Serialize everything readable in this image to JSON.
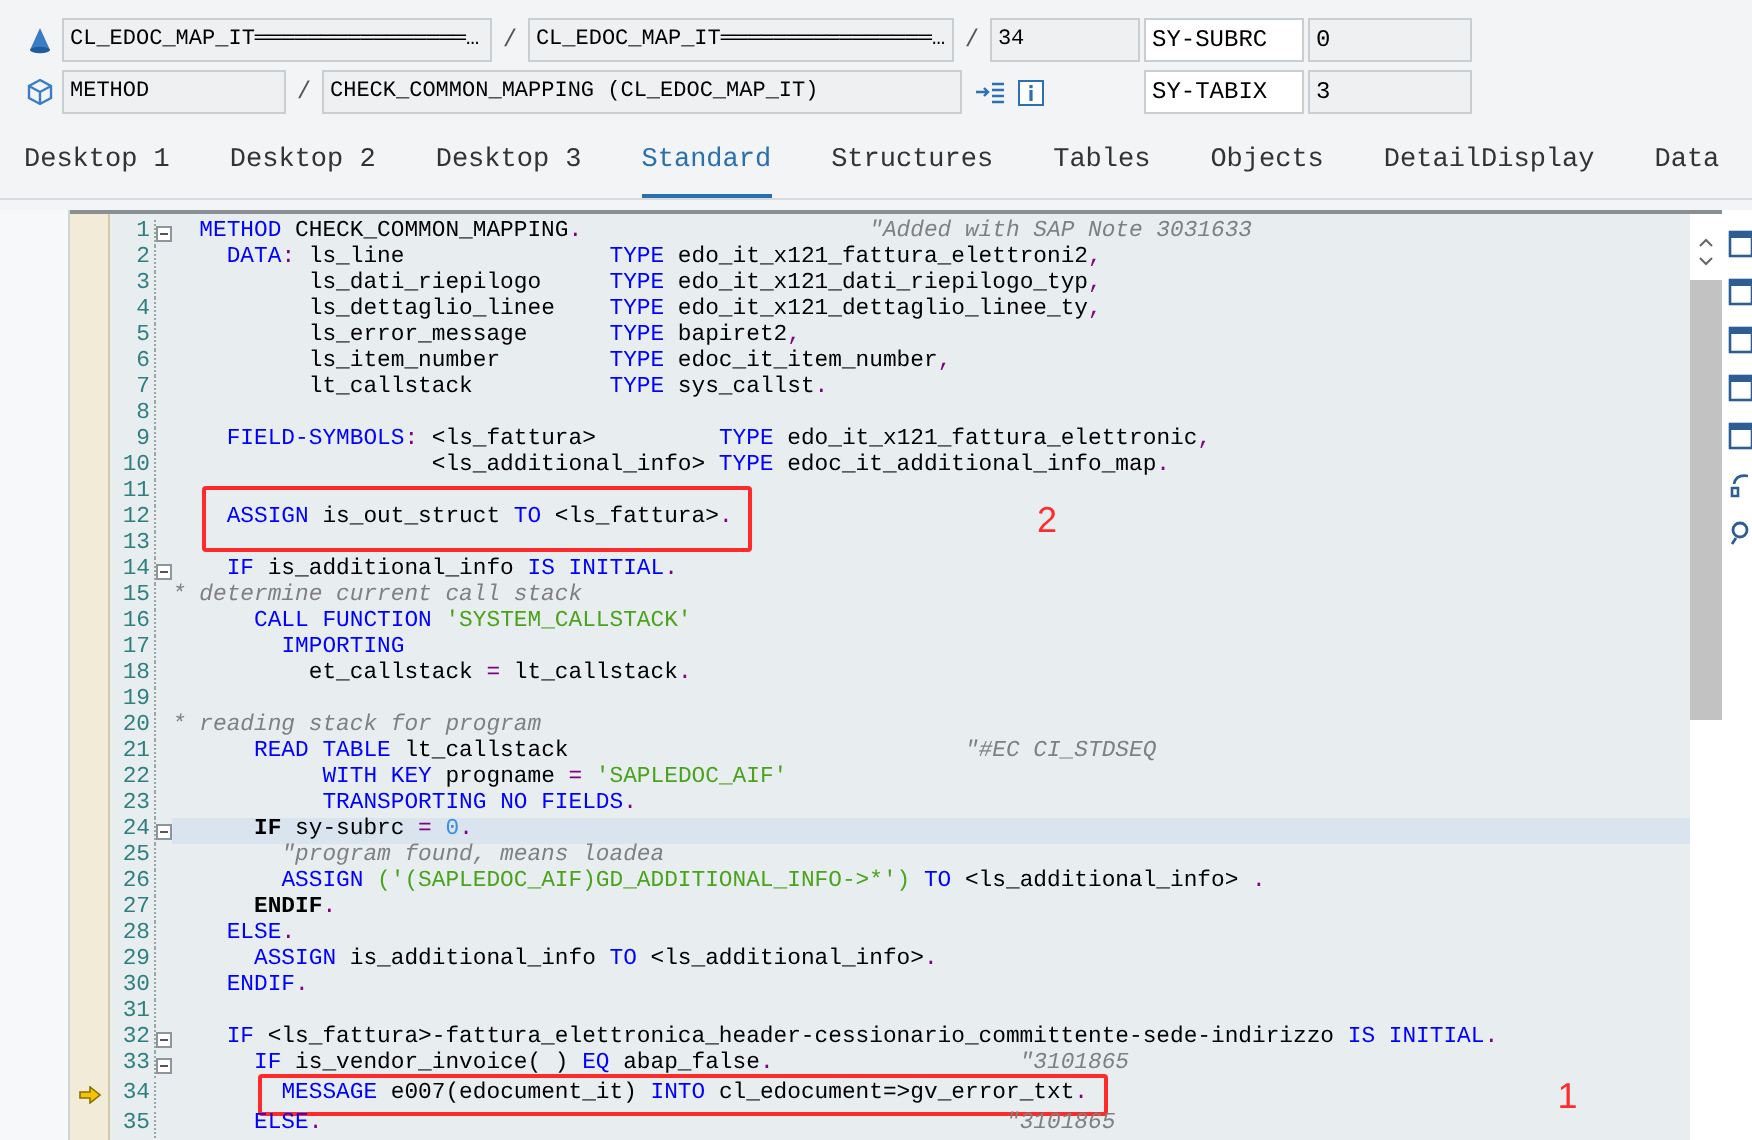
{
  "location_rows": [
    {
      "cells": [
        {
          "kind": "field",
          "text": "CL_EDOC_MAP_IT════════════════…"
        },
        {
          "kind": "separator",
          "text": "/"
        },
        {
          "kind": "field",
          "text": "CL_EDOC_MAP_IT════════════════…"
        },
        {
          "kind": "separator",
          "text": "/"
        },
        {
          "kind": "field",
          "text": "34"
        }
      ]
    },
    {
      "cells": [
        {
          "kind": "field",
          "text": "METHOD"
        },
        {
          "kind": "separator",
          "text": "/"
        },
        {
          "kind": "field",
          "text": "CHECK_COMMON_MAPPING (CL_EDOC_MAP_IT)"
        }
      ]
    }
  ],
  "system_fields": [
    {
      "name": "SY-SUBRC",
      "value": "0"
    },
    {
      "name": "SY-TABIX",
      "value": "3"
    }
  ],
  "tabs": [
    {
      "label": "Desktop 1",
      "selected": false
    },
    {
      "label": "Desktop 2",
      "selected": false
    },
    {
      "label": "Desktop 3",
      "selected": false
    },
    {
      "label": "Standard",
      "selected": true
    },
    {
      "label": "Structures",
      "selected": false
    },
    {
      "label": "Tables",
      "selected": false
    },
    {
      "label": "Objects",
      "selected": false
    },
    {
      "label": "DetailDisplay",
      "selected": false
    },
    {
      "label": "Data",
      "selected": false
    }
  ],
  "lines": [
    {
      "number": "1",
      "fold": true,
      "highlighted": false,
      "executing": false,
      "code": [
        {
          "kind": "keyword",
          "text": "  METHOD"
        },
        {
          "kind": "name",
          "text": " CHECK_COMMON_MAPPING"
        },
        {
          "kind": "punct",
          "text": "."
        },
        {
          "kind": "comment",
          "text": "                     \"Added with SAP Note 3031633"
        }
      ]
    },
    {
      "number": "2",
      "fold": false,
      "highlighted": false,
      "executing": false,
      "code": [
        {
          "kind": "keyword",
          "text": "    DATA"
        },
        {
          "kind": "punct",
          "text": ":"
        },
        {
          "kind": "name",
          "text": " ls_line               "
        },
        {
          "kind": "keyword",
          "text": "TYPE"
        },
        {
          "kind": "name",
          "text": " edo_it_x121_fattura_elettroni2"
        },
        {
          "kind": "punct",
          "text": ","
        }
      ]
    },
    {
      "number": "3",
      "fold": false,
      "highlighted": false,
      "executing": false,
      "code": [
        {
          "kind": "name",
          "text": "          ls_dati_riepilogo     "
        },
        {
          "kind": "keyword",
          "text": "TYPE"
        },
        {
          "kind": "name",
          "text": " edo_it_x121_dati_riepilogo_typ"
        },
        {
          "kind": "punct",
          "text": ","
        }
      ]
    },
    {
      "number": "4",
      "fold": false,
      "highlighted": false,
      "executing": false,
      "code": [
        {
          "kind": "name",
          "text": "          ls_dettaglio_linee    "
        },
        {
          "kind": "keyword",
          "text": "TYPE"
        },
        {
          "kind": "name",
          "text": " edo_it_x121_dettaglio_linee_ty"
        },
        {
          "kind": "punct",
          "text": ","
        }
      ]
    },
    {
      "number": "5",
      "fold": false,
      "highlighted": false,
      "executing": false,
      "code": [
        {
          "kind": "name",
          "text": "          ls_error_message      "
        },
        {
          "kind": "keyword",
          "text": "TYPE"
        },
        {
          "kind": "name",
          "text": " bapiret2"
        },
        {
          "kind": "punct",
          "text": ","
        }
      ]
    },
    {
      "number": "6",
      "fold": false,
      "highlighted": false,
      "executing": false,
      "code": [
        {
          "kind": "name",
          "text": "          ls_item_number        "
        },
        {
          "kind": "keyword",
          "text": "TYPE"
        },
        {
          "kind": "name",
          "text": " edoc_it_item_number"
        },
        {
          "kind": "punct",
          "text": ","
        }
      ]
    },
    {
      "number": "7",
      "fold": false,
      "highlighted": false,
      "executing": false,
      "code": [
        {
          "kind": "name",
          "text": "          lt_callstack          "
        },
        {
          "kind": "keyword",
          "text": "TYPE"
        },
        {
          "kind": "name",
          "text": " sys_callst"
        },
        {
          "kind": "punct",
          "text": "."
        }
      ]
    },
    {
      "number": "8",
      "fold": false,
      "highlighted": false,
      "executing": false
    },
    {
      "number": "9",
      "fold": false,
      "highlighted": false,
      "executing": false,
      "code": [
        {
          "kind": "keyword",
          "text": "    FIELD-SYMBOLS"
        },
        {
          "kind": "punct",
          "text": ":"
        },
        {
          "kind": "name",
          "text": " <ls_fattura>         "
        },
        {
          "kind": "keyword",
          "text": "TYPE"
        },
        {
          "kind": "name",
          "text": " edo_it_x121_fattura_elettronic"
        },
        {
          "kind": "punct",
          "text": ","
        }
      ]
    },
    {
      "number": "10",
      "fold": false,
      "highlighted": false,
      "executing": false,
      "code": [
        {
          "kind": "name",
          "text": "                   <ls_additional_info> "
        },
        {
          "kind": "keyword",
          "text": "TYPE"
        },
        {
          "kind": "name",
          "text": " edoc_it_additional_info_map"
        },
        {
          "kind": "punct",
          "text": "."
        }
      ]
    },
    {
      "number": "11",
      "fold": false,
      "highlighted": false,
      "executing": false
    },
    {
      "number": "12",
      "fold": false,
      "highlighted": false,
      "executing": false,
      "annotation": "2",
      "code": [
        {
          "kind": "keyword",
          "text": "    ASSIGN"
        },
        {
          "kind": "name",
          "text": " is_out_struct "
        },
        {
          "kind": "keyword",
          "text": "TO"
        },
        {
          "kind": "name",
          "text": " <ls_fattura>"
        },
        {
          "kind": "punct",
          "text": "."
        }
      ]
    },
    {
      "number": "13",
      "fold": false,
      "highlighted": false,
      "executing": false
    },
    {
      "number": "14",
      "fold": true,
      "highlighted": false,
      "executing": false,
      "code": [
        {
          "kind": "keyword",
          "text": "    IF"
        },
        {
          "kind": "name",
          "text": " is_additional_info "
        },
        {
          "kind": "keyword",
          "text": "IS INITIAL"
        },
        {
          "kind": "punct",
          "text": "."
        }
      ]
    },
    {
      "number": "15",
      "fold": false,
      "highlighted": false,
      "executing": false,
      "code": [
        {
          "kind": "comment",
          "text": "* determine current call stack"
        }
      ]
    },
    {
      "number": "16",
      "fold": false,
      "highlighted": false,
      "executing": false,
      "code": [
        {
          "kind": "keyword",
          "text": "      CALL FUNCTION"
        },
        {
          "kind": "string",
          "text": " 'SYSTEM_CALLSTACK'"
        }
      ]
    },
    {
      "number": "17",
      "fold": false,
      "highlighted": false,
      "executing": false,
      "code": [
        {
          "kind": "keyword",
          "text": "        IMPORTING"
        }
      ]
    },
    {
      "number": "18",
      "fold": false,
      "highlighted": false,
      "executing": false,
      "code": [
        {
          "kind": "name",
          "text": "          et_callstack "
        },
        {
          "kind": "punct",
          "text": "="
        },
        {
          "kind": "name",
          "text": " lt_callstack"
        },
        {
          "kind": "punct",
          "text": "."
        }
      ]
    },
    {
      "number": "19",
      "fold": false,
      "highlighted": false,
      "executing": false
    },
    {
      "number": "20",
      "fold": false,
      "highlighted": false,
      "executing": false,
      "code": [
        {
          "kind": "comment",
          "text": "* reading stack for program"
        }
      ]
    },
    {
      "number": "21",
      "fold": false,
      "highlighted": false,
      "executing": false,
      "code": [
        {
          "kind": "keyword",
          "text": "      READ TABLE"
        },
        {
          "kind": "name",
          "text": " lt_callstack"
        },
        {
          "kind": "comment",
          "text": "                             \"#EC CI_STDSEQ"
        }
      ]
    },
    {
      "number": "22",
      "fold": false,
      "highlighted": false,
      "executing": false,
      "code": [
        {
          "kind": "keyword",
          "text": "           WITH KEY"
        },
        {
          "kind": "name",
          "text": " progname "
        },
        {
          "kind": "punct",
          "text": "="
        },
        {
          "kind": "string",
          "text": " 'SAPLEDOC_AIF'"
        }
      ]
    },
    {
      "number": "23",
      "fold": false,
      "highlighted": false,
      "executing": false,
      "code": [
        {
          "kind": "keyword",
          "text": "           TRANSPORTING NO FIELDS"
        },
        {
          "kind": "punct",
          "text": "."
        }
      ]
    },
    {
      "number": "24",
      "fold": true,
      "highlighted": true,
      "executing": false,
      "code": [
        {
          "kind": "bold",
          "text": "      IF"
        },
        {
          "kind": "name",
          "text": " sy-subrc "
        },
        {
          "kind": "punct",
          "text": "="
        },
        {
          "kind": "number",
          "text": " 0"
        },
        {
          "kind": "punct",
          "text": "."
        }
      ]
    },
    {
      "number": "25",
      "fold": false,
      "highlighted": false,
      "executing": false,
      "code": [
        {
          "kind": "comment",
          "text": "        \"program found, means loadea"
        }
      ]
    },
    {
      "number": "26",
      "fold": false,
      "highlighted": false,
      "executing": false,
      "code": [
        {
          "kind": "keyword",
          "text": "        ASSIGN"
        },
        {
          "kind": "string",
          "text": " ('(SAPLEDOC_AIF)GD_ADDITIONAL_INFO->*')"
        },
        {
          "kind": "keyword",
          "text": " TO"
        },
        {
          "kind": "name",
          "text": " <ls_additional_info> "
        },
        {
          "kind": "punct",
          "text": "."
        }
      ]
    },
    {
      "number": "27",
      "fold": false,
      "highlighted": false,
      "executing": false,
      "code": [
        {
          "kind": "bold",
          "text": "      ENDIF"
        },
        {
          "kind": "punct",
          "text": "."
        }
      ]
    },
    {
      "number": "28",
      "fold": false,
      "highlighted": false,
      "executing": false,
      "code": [
        {
          "kind": "keyword",
          "text": "    ELSE"
        },
        {
          "kind": "punct",
          "text": "."
        }
      ]
    },
    {
      "number": "29",
      "fold": false,
      "highlighted": false,
      "executing": false,
      "code": [
        {
          "kind": "keyword",
          "text": "      ASSIGN"
        },
        {
          "kind": "name",
          "text": " is_additional_info "
        },
        {
          "kind": "keyword",
          "text": "TO"
        },
        {
          "kind": "name",
          "text": " <ls_additional_info>"
        },
        {
          "kind": "punct",
          "text": "."
        }
      ]
    },
    {
      "number": "30",
      "fold": false,
      "highlighted": false,
      "executing": false,
      "code": [
        {
          "kind": "keyword",
          "text": "    ENDIF"
        },
        {
          "kind": "punct",
          "text": "."
        }
      ]
    },
    {
      "number": "31",
      "fold": false,
      "highlighted": false,
      "executing": false
    },
    {
      "number": "32",
      "fold": true,
      "highlighted": false,
      "executing": false,
      "code": [
        {
          "kind": "keyword",
          "text": "    IF"
        },
        {
          "kind": "name",
          "text": " <ls_fattura>-fattura_elettronica_header-cessionario_committente-sede-indirizzo "
        },
        {
          "kind": "keyword",
          "text": "IS INITIAL"
        },
        {
          "kind": "punct",
          "text": "."
        }
      ]
    },
    {
      "number": "33",
      "fold": true,
      "highlighted": false,
      "executing": false,
      "code": [
        {
          "kind": "keyword",
          "text": "      IF"
        },
        {
          "kind": "name",
          "text": " is_vendor_invoice( ) "
        },
        {
          "kind": "keyword",
          "text": "EQ"
        },
        {
          "kind": "name",
          "text": " abap_false"
        },
        {
          "kind": "punct",
          "text": "."
        },
        {
          "kind": "comment",
          "text": "                  \"3101865"
        }
      ]
    },
    {
      "number": "34",
      "fold": false,
      "highlighted": false,
      "executing": true,
      "annotation": "1",
      "code": [
        {
          "kind": "keyword",
          "text": "        MESSAGE"
        },
        {
          "kind": "name",
          "text": " e007(edocument_it) "
        },
        {
          "kind": "keyword",
          "text": "INTO"
        },
        {
          "kind": "name",
          "text": " cl_edocument=>gv_error_txt"
        },
        {
          "kind": "punct",
          "text": "."
        }
      ]
    },
    {
      "number": "35",
      "fold": false,
      "highlighted": false,
      "executing": false,
      "code": [
        {
          "kind": "keyword",
          "text": "      ELSE"
        },
        {
          "kind": "punct",
          "text": "."
        },
        {
          "kind": "comment",
          "text": "                                                  \"3101865"
        }
      ]
    }
  ]
}
